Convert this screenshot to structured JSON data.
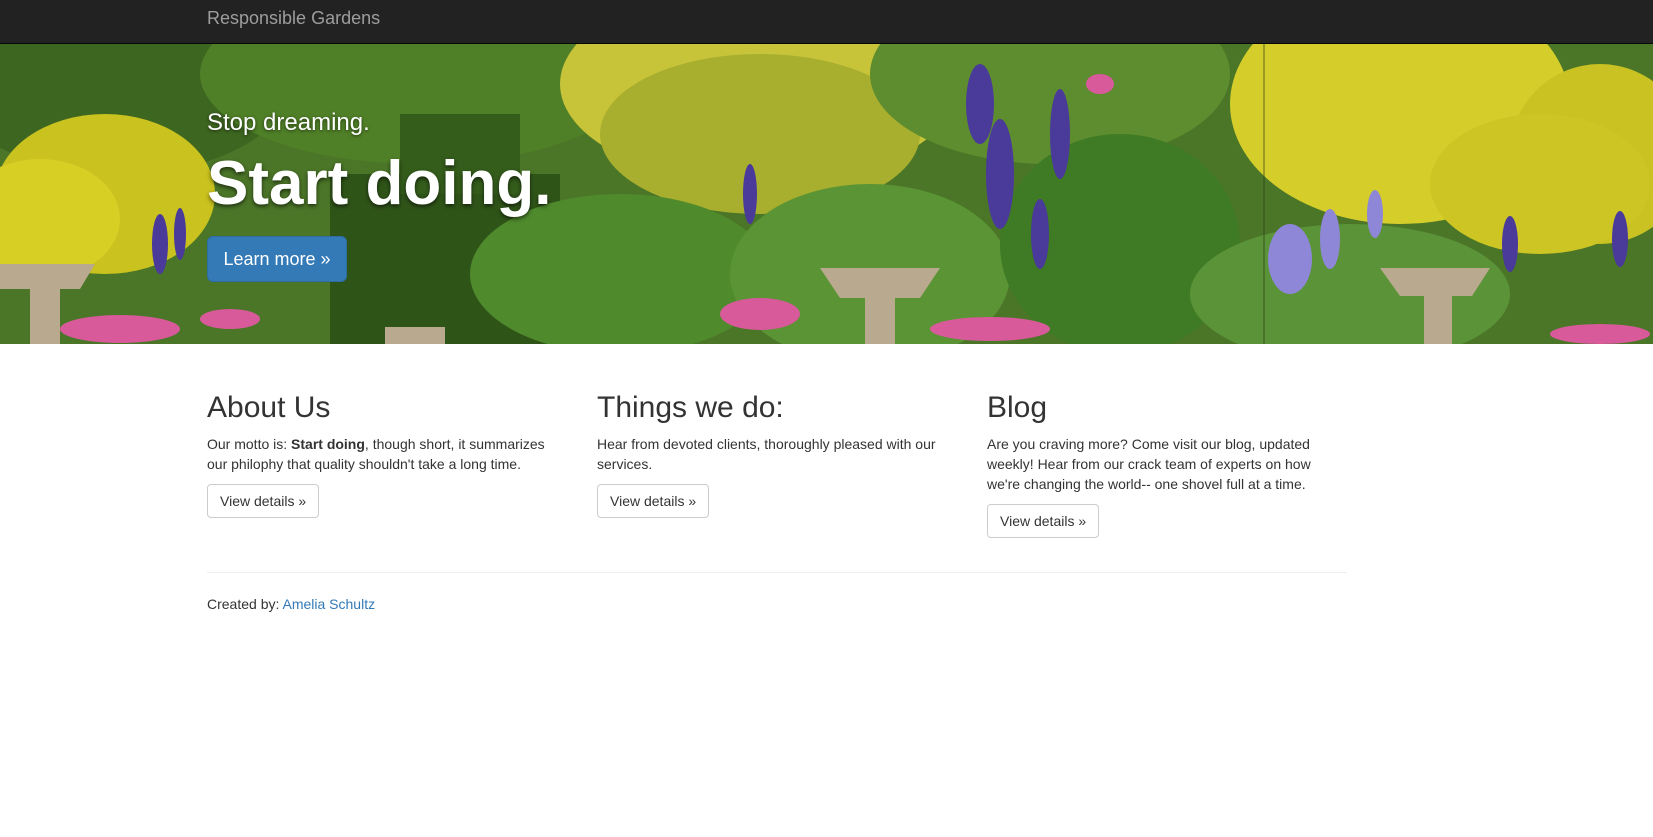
{
  "navbar": {
    "brand": "Responsible Gardens"
  },
  "hero": {
    "tagline": "Stop dreaming.",
    "title": "Start doing.",
    "button_label": "Learn more »"
  },
  "columns": [
    {
      "heading": "About Us",
      "text_before": "Our motto is: ",
      "text_bold": "Start doing",
      "text_after": ", though short, it summarizes our philophy that quality shouldn't take a long time.",
      "button_label": "View details »"
    },
    {
      "heading": "Things we do:",
      "text": "Hear from devoted clients, thoroughly pleased with our services.",
      "button_label": "View details »"
    },
    {
      "heading": "Blog",
      "text": "Are you craving more? Come visit our blog, updated weekly! Hear from our crack team of experts on how we're changing the world-- one shovel full at a time.",
      "button_label": "View details »"
    }
  ],
  "footer": {
    "label": "Created by: ",
    "author": "Amelia Schultz"
  },
  "colors": {
    "navbar_bg": "#222222",
    "brand_text": "#9d9d9d",
    "primary": "#337ab7",
    "text": "#333333"
  }
}
